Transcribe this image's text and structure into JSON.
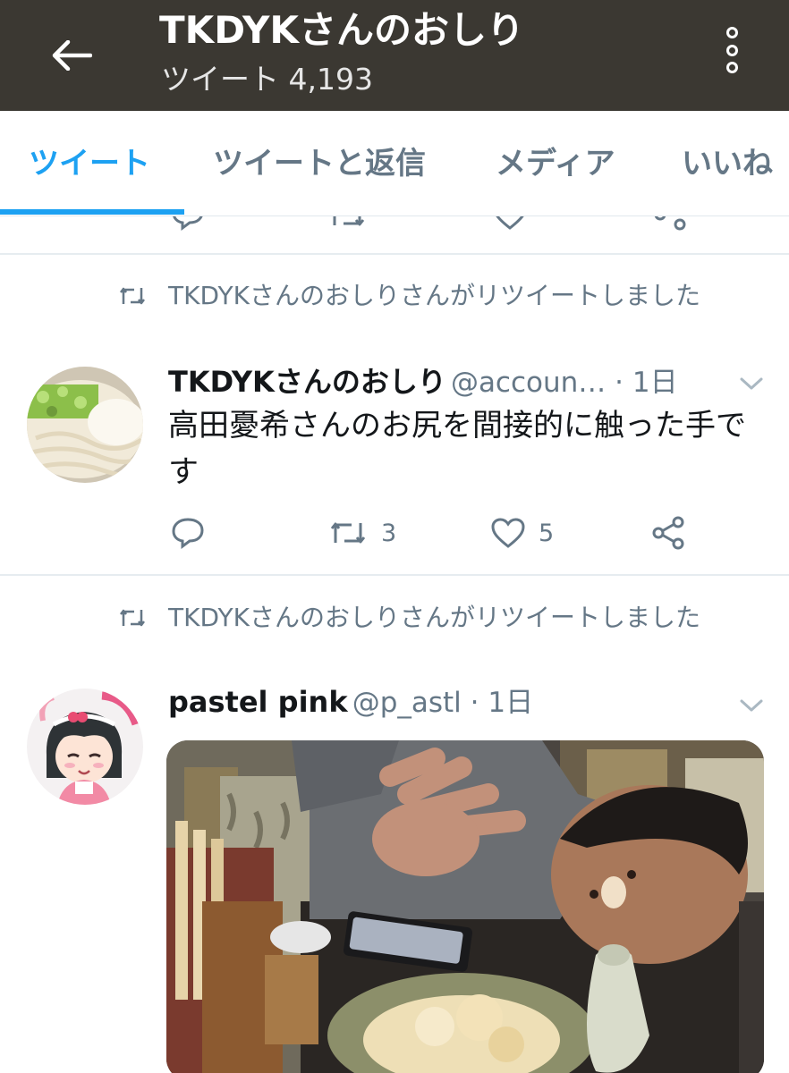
{
  "header": {
    "title": "TKDYKさんのおしり",
    "subtitle": "ツイート 4,193"
  },
  "tabs": [
    {
      "label": "ツイート",
      "active": true
    },
    {
      "label": "ツイートと返信",
      "active": false
    },
    {
      "label": "メディア",
      "active": false
    },
    {
      "label": "いいね",
      "active": false
    }
  ],
  "tweets": [
    {
      "retweet_notice": "TKDYKさんのおしりさんがリツイートしました",
      "display_name": "TKDYKさんのおしり",
      "handle_time": "@accoun… · 1日",
      "text": "高田憂希さんのお尻を間接的に触った手です",
      "retweet_count": "3",
      "like_count": "5"
    },
    {
      "retweet_notice": "TKDYKさんのおしりさんがリツイートしました",
      "display_name": "pastel pink",
      "handle_time": "@p_astl · 1日"
    }
  ],
  "colors": {
    "header_bg": "#3b3832",
    "accent": "#1da1f2",
    "secondary_text": "#657786",
    "divider": "#e6ecf0"
  },
  "icons": {
    "back": "arrow-left-icon",
    "more": "more-vertical-icon",
    "retweet": "retweet-icon",
    "reply": "reply-icon",
    "like": "heart-icon",
    "share": "share-icon",
    "caret": "chevron-down-icon"
  }
}
